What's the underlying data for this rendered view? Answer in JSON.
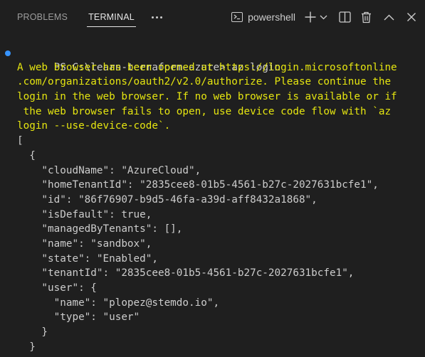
{
  "tabs": {
    "problems": "PROBLEMS",
    "terminal": "TERMINAL"
  },
  "toolbar": {
    "shell_label": "powershell"
  },
  "terminal": {
    "prompt": "PS C:\\learn-terraform-azure> ",
    "command": "az login",
    "message_lines": [
      "A web browser has been opened at https://login.microsoftonline",
      ".com/organizations/oauth2/v2.0/authorize. Please continue the",
      "login in the web browser. If no web browser is available or if",
      " the web browser fails to open, use device code flow with `az",
      "login --use-device-code`."
    ],
    "output_lines": [
      "[",
      "  {",
      "    \"cloudName\": \"AzureCloud\",",
      "    \"homeTenantId\": \"2835cee8-01b5-4561-b27c-2027631bcfe1\",",
      "    \"id\": \"86f76907-b9d5-46fa-a39d-aff8432a1868\",",
      "    \"isDefault\": true,",
      "    \"managedByTenants\": [],",
      "    \"name\": \"sandbox\",",
      "    \"state\": \"Enabled\",",
      "    \"tenantId\": \"2835cee8-01b5-4561-b27c-2027631bcfe1\",",
      "    \"user\": {",
      "      \"name\": \"plopez@stemdo.io\",",
      "      \"type\": \"user\"",
      "    }",
      "  }"
    ]
  },
  "colors": {
    "background": "#1f1f1f",
    "text": "#cccccc",
    "message": "#e5e510",
    "prompt_dot": "#3794ff"
  }
}
